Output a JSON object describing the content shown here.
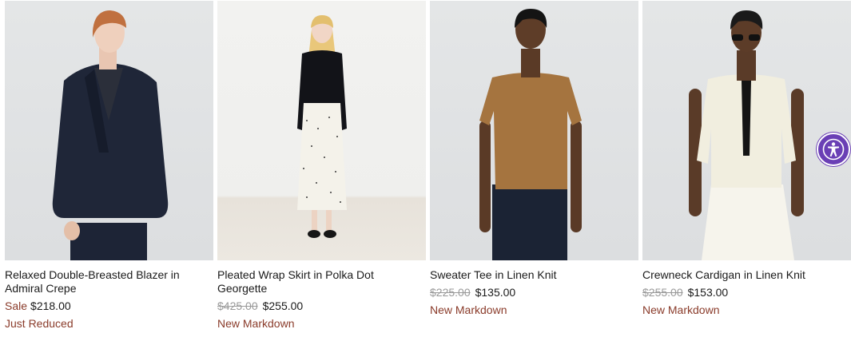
{
  "products": [
    {
      "title": "Relaxed Double-Breasted Blazer in Admiral Crepe",
      "sale_label": "Sale",
      "original_price": "",
      "price": "$218.00",
      "badge": "Just Reduced"
    },
    {
      "title": "Pleated Wrap Skirt in Polka Dot Georgette",
      "sale_label": "",
      "original_price": "$425.00",
      "price": "$255.00",
      "badge": "New Markdown"
    },
    {
      "title": "Sweater Tee in Linen Knit",
      "sale_label": "",
      "original_price": "$225.00",
      "price": "$135.00",
      "badge": "New Markdown"
    },
    {
      "title": "Crewneck Cardigan in Linen Knit",
      "sale_label": "",
      "original_price": "$255.00",
      "price": "$153.00",
      "badge": "New Markdown"
    }
  ],
  "accessibility_button": {
    "icon": "accessibility-icon"
  },
  "colors": {
    "sale_red": "#8a3b2a",
    "accessibility_purple": "#6a3fb5"
  }
}
